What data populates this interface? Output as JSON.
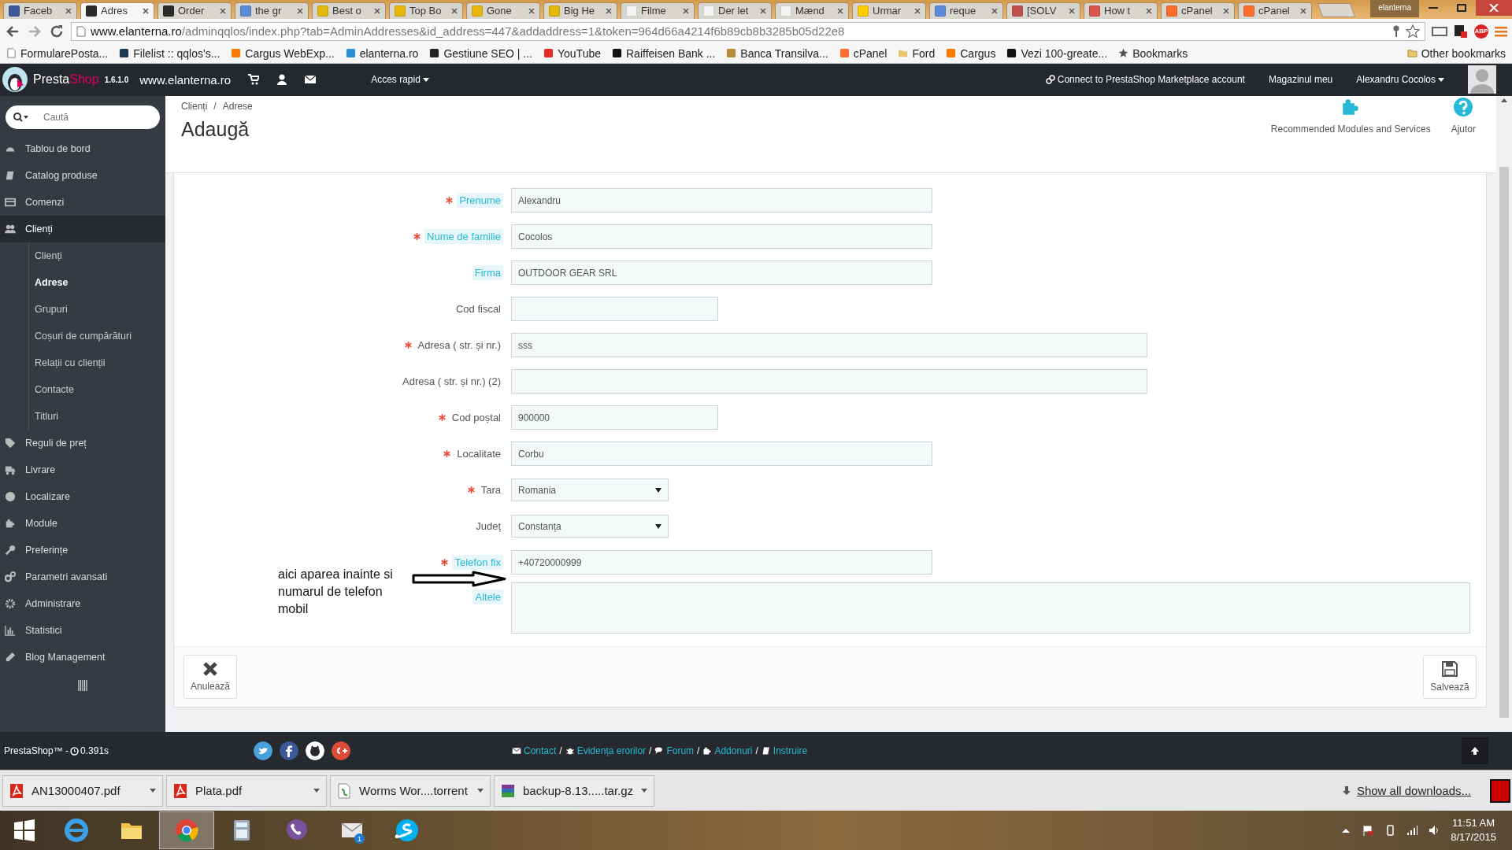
{
  "browser": {
    "tabs": [
      {
        "title": "Faceb",
        "selected": false,
        "color": "#3b5998"
      },
      {
        "title": "Adres",
        "selected": true,
        "color": "#2b2b2b"
      },
      {
        "title": "Order",
        "selected": false,
        "color": "#2b2b2b"
      },
      {
        "title": "the gr",
        "selected": false,
        "color": "#5b8ad8"
      },
      {
        "title": "Best o",
        "selected": false,
        "color": "#e5b80b"
      },
      {
        "title": "Top Bo",
        "selected": false,
        "color": "#e5b80b"
      },
      {
        "title": "Gone",
        "selected": false,
        "color": "#e5b80b"
      },
      {
        "title": "Big He",
        "selected": false,
        "color": "#e5b80b"
      },
      {
        "title": "Filme",
        "selected": false,
        "color": "#f4f4f4"
      },
      {
        "title": "Der let",
        "selected": false,
        "color": "#f4f4f4"
      },
      {
        "title": "Mænd",
        "selected": false,
        "color": "#f4f4f4"
      },
      {
        "title": "Urmar",
        "selected": false,
        "color": "#ffcc00"
      },
      {
        "title": "reque",
        "selected": false,
        "color": "#5b8ad8"
      },
      {
        "title": "[SOLV",
        "selected": false,
        "color": "#c0504d"
      },
      {
        "title": "How t",
        "selected": false,
        "color": "#d9534f"
      },
      {
        "title": "cPanel",
        "selected": false,
        "color": "#ff6c2c"
      },
      {
        "title": "cPanel",
        "selected": false,
        "color": "#ff6c2c"
      }
    ],
    "profile": "elanterna",
    "url_host": "www.elanterna.ro",
    "url_path": "/adminqqlos/index.php?tab=AdminAddresses&id_address=447&addaddress=1&token=964d66a4214f6b89cb8b3285b05d22e8",
    "adblock": "ABP",
    "bookmarks": [
      {
        "label": "FormularePosta...",
        "kind": "page"
      },
      {
        "label": "Filelist :: qqlos's...",
        "kind": "site",
        "color": "#1d3b55"
      },
      {
        "label": "Cargus WebExp...",
        "kind": "site",
        "color": "#ff7a00"
      },
      {
        "label": "elanterna.ro",
        "kind": "site",
        "color": "#2a8fd6"
      },
      {
        "label": "Gestiune SEO | ...",
        "kind": "site",
        "color": "#222222"
      },
      {
        "label": "YouTube",
        "kind": "site",
        "color": "#e52d27"
      },
      {
        "label": "Raiffeisen Bank ...",
        "kind": "site",
        "color": "#111111"
      },
      {
        "label": "Banca Transilva...",
        "kind": "site",
        "color": "#b58a3c"
      },
      {
        "label": "cPanel",
        "kind": "site",
        "color": "#ff6c2c"
      },
      {
        "label": "Ford",
        "kind": "folder",
        "color": "#e8c46a"
      },
      {
        "label": "Cargus",
        "kind": "site",
        "color": "#ff7a00"
      },
      {
        "label": "Vezi 100-greate...",
        "kind": "site",
        "color": "#111111"
      },
      {
        "label": "Bookmarks",
        "kind": "star",
        "color": "#555555"
      }
    ],
    "other_bookmarks": "Other bookmarks"
  },
  "admin_header": {
    "brand_main": "Presta",
    "brand_accent": "Shop",
    "version": "1.6.1.0",
    "site": "www.elanterna.ro",
    "quick_access": "Acces rapid",
    "marketplace": "Connect to PrestaShop Marketplace account",
    "my_shop": "Magazinul meu",
    "employee": "Alexandru Cocolos"
  },
  "sidebar": {
    "search_placeholder": "Caută",
    "items": [
      {
        "label": "Tablou de bord",
        "selected": false
      },
      {
        "label": "Catalog produse",
        "selected": false
      },
      {
        "label": "Comenzi",
        "selected": false
      },
      {
        "label": "Clienți",
        "selected": true,
        "children": [
          {
            "label": "Clienți",
            "selected": false
          },
          {
            "label": "Adrese",
            "selected": true
          },
          {
            "label": "Grupuri",
            "selected": false
          },
          {
            "label": "Coșuri de cumpărături",
            "selected": false
          },
          {
            "label": "Relații cu clienții",
            "selected": false
          },
          {
            "label": "Contacte",
            "selected": false
          },
          {
            "label": "Titluri",
            "selected": false
          }
        ]
      },
      {
        "label": "Reguli de preț",
        "selected": false
      },
      {
        "label": "Livrare",
        "selected": false
      },
      {
        "label": "Localizare",
        "selected": false
      },
      {
        "label": "Module",
        "selected": false
      },
      {
        "label": "Preferințe",
        "selected": false
      },
      {
        "label": "Parametri avansati",
        "selected": false
      },
      {
        "label": "Administrare",
        "selected": false
      },
      {
        "label": "Statistici",
        "selected": false
      },
      {
        "label": "Blog Management",
        "selected": false
      }
    ]
  },
  "page_header": {
    "breadcrumb": [
      "Clienți",
      "Adrese"
    ],
    "breadcrumb_separator": "/",
    "title": "Adaugă",
    "toolbar": [
      {
        "label": "Recommended Modules and Services"
      },
      {
        "label": "Ajutor"
      }
    ]
  },
  "form": {
    "fields": [
      {
        "label": "Prenume",
        "required": true,
        "tooltip": true,
        "kind": "input",
        "value": "Alexandru"
      },
      {
        "label": "Nume de familie",
        "required": true,
        "tooltip": true,
        "kind": "input",
        "value": "Cocolos"
      },
      {
        "label": "Firma",
        "required": false,
        "tooltip": true,
        "kind": "input",
        "value": "OUTDOOR GEAR SRL"
      },
      {
        "label": "Cod fiscal",
        "required": false,
        "tooltip": false,
        "kind": "short"
      },
      {
        "label": "Adresa ( str. și nr.)",
        "required": true,
        "tooltip": false,
        "kind": "long",
        "value": "sss"
      },
      {
        "label": "Adresa ( str. și nr.) (2)",
        "required": false,
        "tooltip": false,
        "kind": "long"
      },
      {
        "label": "Cod poștal",
        "required": true,
        "tooltip": false,
        "kind": "short",
        "value": "900000"
      },
      {
        "label": "Localitate",
        "required": true,
        "tooltip": false,
        "kind": "input",
        "value": "Corbu"
      },
      {
        "label": "Tara",
        "required": true,
        "tooltip": false,
        "kind": "select",
        "value": "Romania"
      },
      {
        "label": "Județ",
        "required": false,
        "tooltip": false,
        "kind": "select",
        "value": "Constanța"
      },
      {
        "label": "Telefon fix",
        "required": true,
        "tooltip": true,
        "kind": "input",
        "value": "+40720000999"
      },
      {
        "label": "Altele",
        "required": false,
        "tooltip": true,
        "kind": "textarea"
      }
    ],
    "annotation": "aici aparea inainte si numarul de telefon mobil",
    "cancel": "Anulează",
    "save": "Salvează"
  },
  "footer": {
    "brand": "PrestaShop™ - ",
    "load_time": "0.391s",
    "links": [
      {
        "label": "Contact",
        "separator": "/"
      },
      {
        "label": "Evidența erorilor",
        "separator": "/"
      },
      {
        "label": "Forum",
        "separator": "/"
      },
      {
        "label": "Addonuri",
        "separator": "/"
      },
      {
        "label": "Instruire"
      }
    ]
  },
  "downloads": {
    "items": [
      {
        "name": "AN13000407.pdf"
      },
      {
        "name": "Plata.pdf"
      },
      {
        "name": "Worms Wor....torrent"
      },
      {
        "name": "backup-8.13.....tar.gz"
      }
    ],
    "show_all": "Show all downloads..."
  },
  "taskbar": {
    "apps": [
      {
        "selected": false
      },
      {
        "selected": false
      },
      {
        "selected": true
      },
      {
        "selected": false
      },
      {
        "selected": false
      },
      {
        "selected": false,
        "badge": "1"
      },
      {
        "selected": false
      }
    ],
    "time": "11:51 AM",
    "date": "8/17/2015"
  }
}
